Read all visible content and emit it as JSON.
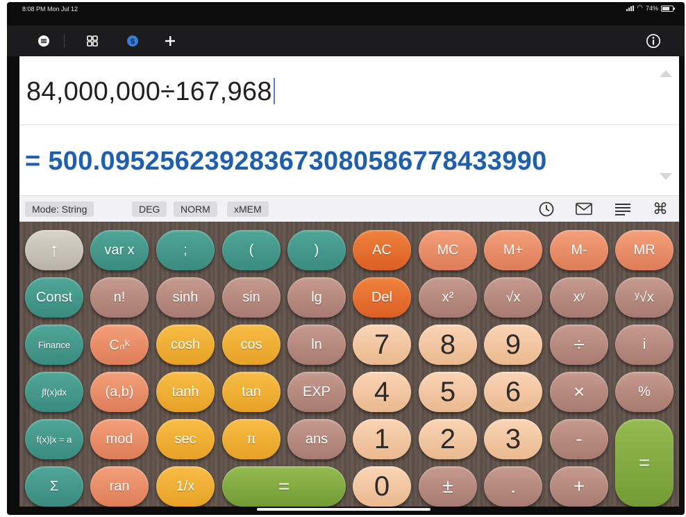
{
  "status_bar": {
    "time": "8:08 PM  Mon Jul 12",
    "battery": "74%"
  },
  "toolbar": {
    "items": [
      {
        "name": "menu-icon",
        "glyph": "≡"
      },
      {
        "name": "grid-icon",
        "glyph": "▦"
      },
      {
        "name": "currency-icon",
        "glyph": "$"
      },
      {
        "name": "add-icon",
        "glyph": "+"
      }
    ],
    "info_glyph": "i"
  },
  "display": {
    "expression": "84,000,000÷167,968",
    "result": "= 500.095256239283673080586778433990"
  },
  "info_bar": {
    "mode": "Mode: String",
    "angle": "DEG",
    "format": "NORM",
    "memory": "xMEM",
    "icons": [
      "history-icon",
      "mail-icon",
      "text-icon",
      "command-icon"
    ],
    "icon_glyphs": [
      "◴",
      "✉",
      "≡",
      "⌘"
    ]
  },
  "keys": {
    "row1": [
      "↑",
      "var x",
      ";",
      "(",
      ")",
      "AC",
      "MC",
      "M+",
      "M-",
      "MR"
    ],
    "row2": [
      "Const",
      "n!",
      "sinh",
      "sin",
      "lg",
      "Del",
      "x²",
      "√x",
      "xʸ",
      "ʸ√x"
    ],
    "row3": [
      "Finance",
      "Cₙᵏ",
      "cosh",
      "cos",
      "ln",
      "7",
      "8",
      "9",
      "÷",
      "i"
    ],
    "row4": [
      "∫f(x)dx",
      "(a,b)",
      "tanh",
      "tan",
      "EXP",
      "4",
      "5",
      "6",
      "×",
      "%"
    ],
    "row5": [
      "f(x)|x = a",
      "mod",
      "sec",
      "π",
      "ans",
      "1",
      "2",
      "3",
      "-",
      "="
    ],
    "row6": [
      "Σ",
      "ran",
      "1/x",
      "=",
      "0",
      "±",
      ".",
      "+"
    ]
  },
  "colors": {
    "result": "#1f5fb0",
    "teal": "#3b8b7f",
    "orange": "#db5f24",
    "salmon": "#de7d59",
    "mauve": "#a77b71",
    "yellow": "#e7a126",
    "green": "#739b35",
    "peach": "#eab98f"
  }
}
